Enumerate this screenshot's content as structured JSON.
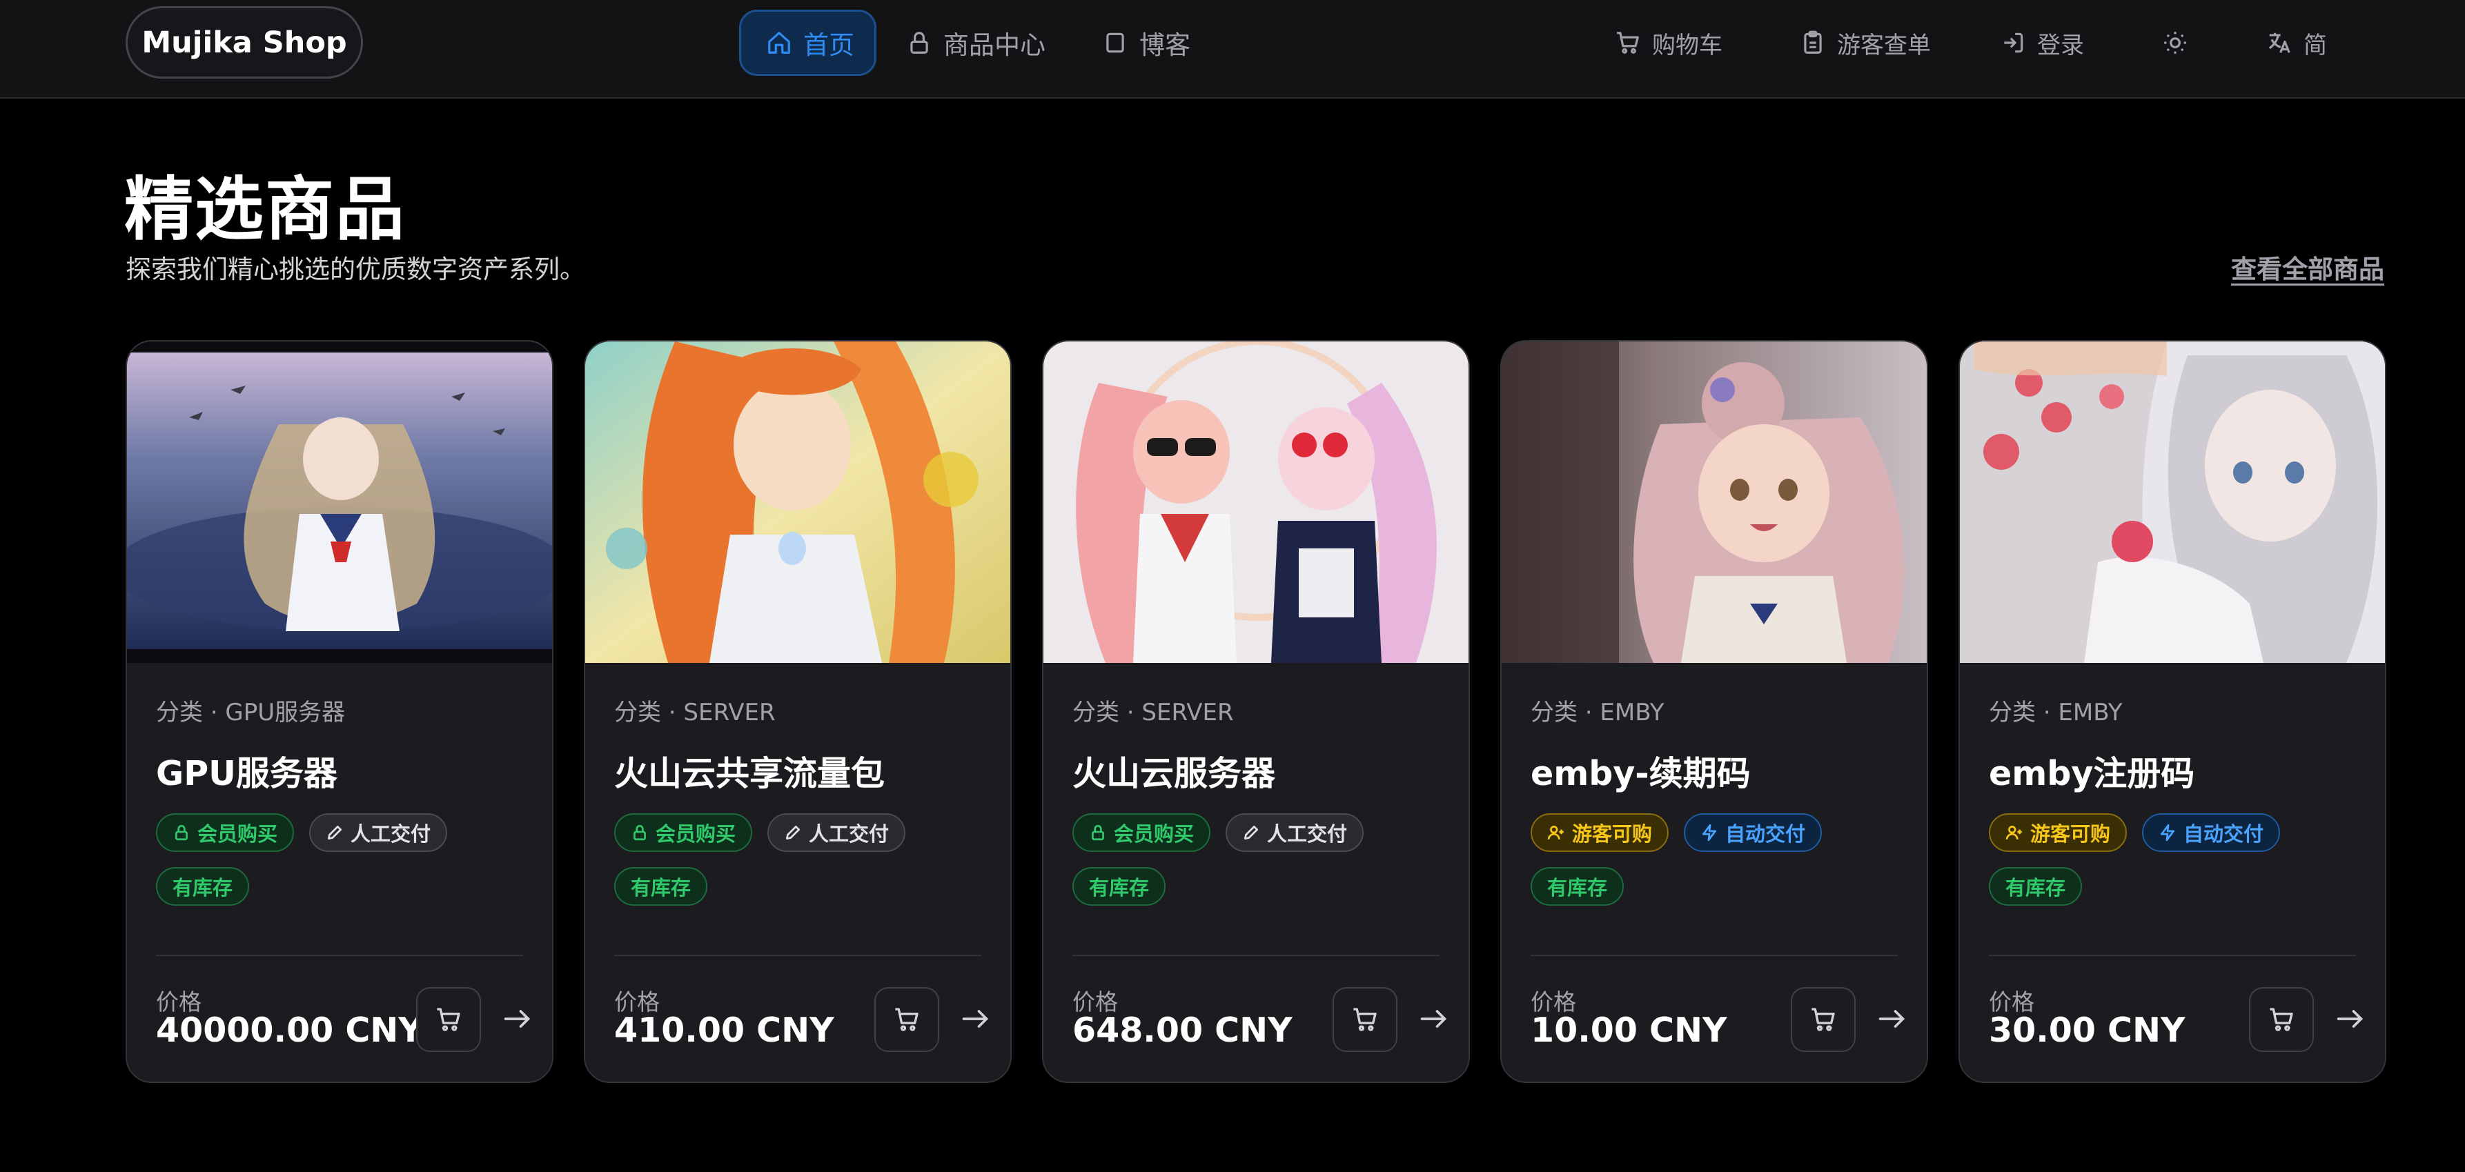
{
  "header": {
    "logo": "Mujika Shop",
    "nav": {
      "home": "首页",
      "goods": "商品中心",
      "blog": "博客",
      "cart": "购物车",
      "guest_orders": "游客查单",
      "login": "登录",
      "lang": "简"
    },
    "active_color": "#2f8cf5"
  },
  "section": {
    "title": "精选商品",
    "subtitle": "探索我们精心挑选的优质数字资产系列。",
    "view_all": "查看全部商品"
  },
  "price_label": "价格",
  "products": [
    {
      "category": "分类 · GPU服务器",
      "name": "GPU服务器",
      "tag_purchase": "会员购买",
      "tag_delivery": "人工交付",
      "tag_stock": "有库存",
      "price": "40000.00 CNY",
      "image": "anime-girl-beach-seagulls"
    },
    {
      "category": "分类 · SERVER",
      "name": "火山云共享流量包",
      "tag_purchase": "会员购买",
      "tag_delivery": "人工交付",
      "tag_stock": "有库存",
      "price": "410.00 CNY",
      "image": "anime-girl-orange-hair-flowers"
    },
    {
      "category": "分类 · SERVER",
      "name": "火山云服务器",
      "tag_purchase": "会员购买",
      "tag_delivery": "人工交付",
      "tag_stock": "有库存",
      "price": "648.00 CNY",
      "image": "two-anime-girls-sunglasses"
    },
    {
      "category": "分类 · EMBY",
      "name": "emby-续期码",
      "tag_purchase": "游客可购",
      "tag_delivery": "自动交付",
      "tag_stock": "有库存",
      "price": "10.00 CNY",
      "image": "anime-girl-pink-hair-bun"
    },
    {
      "category": "分类 · EMBY",
      "name": "emby注册码",
      "tag_purchase": "游客可购",
      "tag_delivery": "自动交付",
      "tag_stock": "有库存",
      "price": "30.00 CNY",
      "image": "anime-girl-silver-hair-roses"
    }
  ]
}
